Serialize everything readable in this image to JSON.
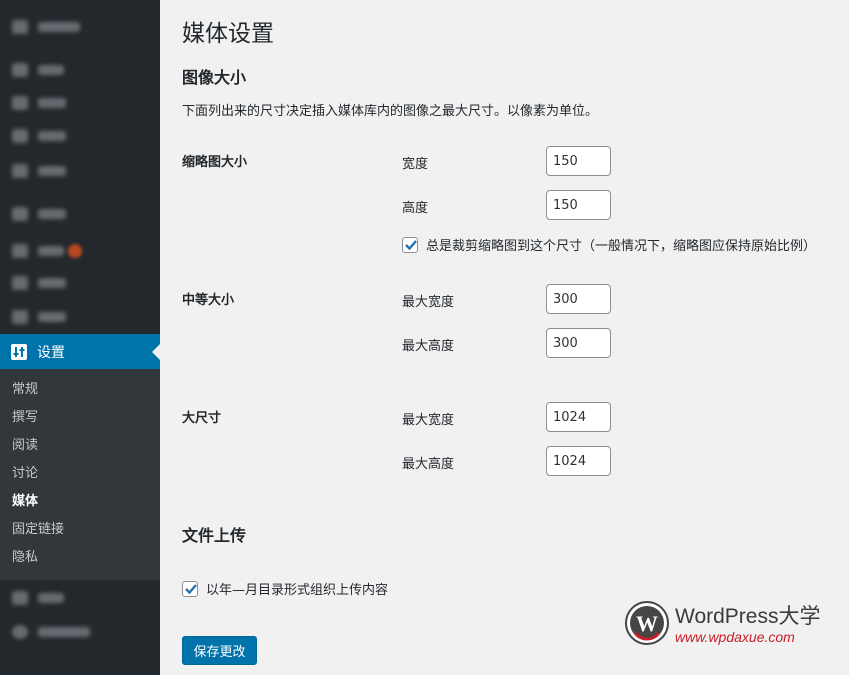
{
  "sidebar": {
    "settings_label": "设置",
    "submenu": [
      "常规",
      "撰写",
      "阅读",
      "讨论",
      "媒体",
      "固定链接",
      "隐私"
    ],
    "current": "媒体"
  },
  "main": {
    "title": "媒体设置",
    "image_sizes": {
      "heading": "图像大小",
      "description": "下面列出来的尺寸决定插入媒体库内的图像之最大尺寸。以像素为单位。",
      "thumbnail": {
        "label": "缩略图大小",
        "width_label": "宽度",
        "width_value": "150",
        "height_label": "高度",
        "height_value": "150",
        "crop_label": "总是裁剪缩略图到这个尺寸（一般情况下，缩略图应保持原始比例）",
        "crop_checked": true
      },
      "medium": {
        "label": "中等大小",
        "max_width_label": "最大宽度",
        "max_width_value": "300",
        "max_height_label": "最大高度",
        "max_height_value": "300"
      },
      "large": {
        "label": "大尺寸",
        "max_width_label": "最大宽度",
        "max_width_value": "1024",
        "max_height_label": "最大高度",
        "max_height_value": "1024"
      }
    },
    "uploads": {
      "heading": "文件上传",
      "organize_label": "以年—月目录形式组织上传内容",
      "organize_checked": true
    },
    "save_label": "保存更改"
  },
  "watermark": {
    "name": "WordPress大学",
    "url": "www.wpdaxue.com"
  },
  "colors": {
    "sidebar_bg": "#23282d",
    "submenu_bg": "#32373c",
    "accent": "#0073aa",
    "page_bg": "#f1f1f1"
  }
}
